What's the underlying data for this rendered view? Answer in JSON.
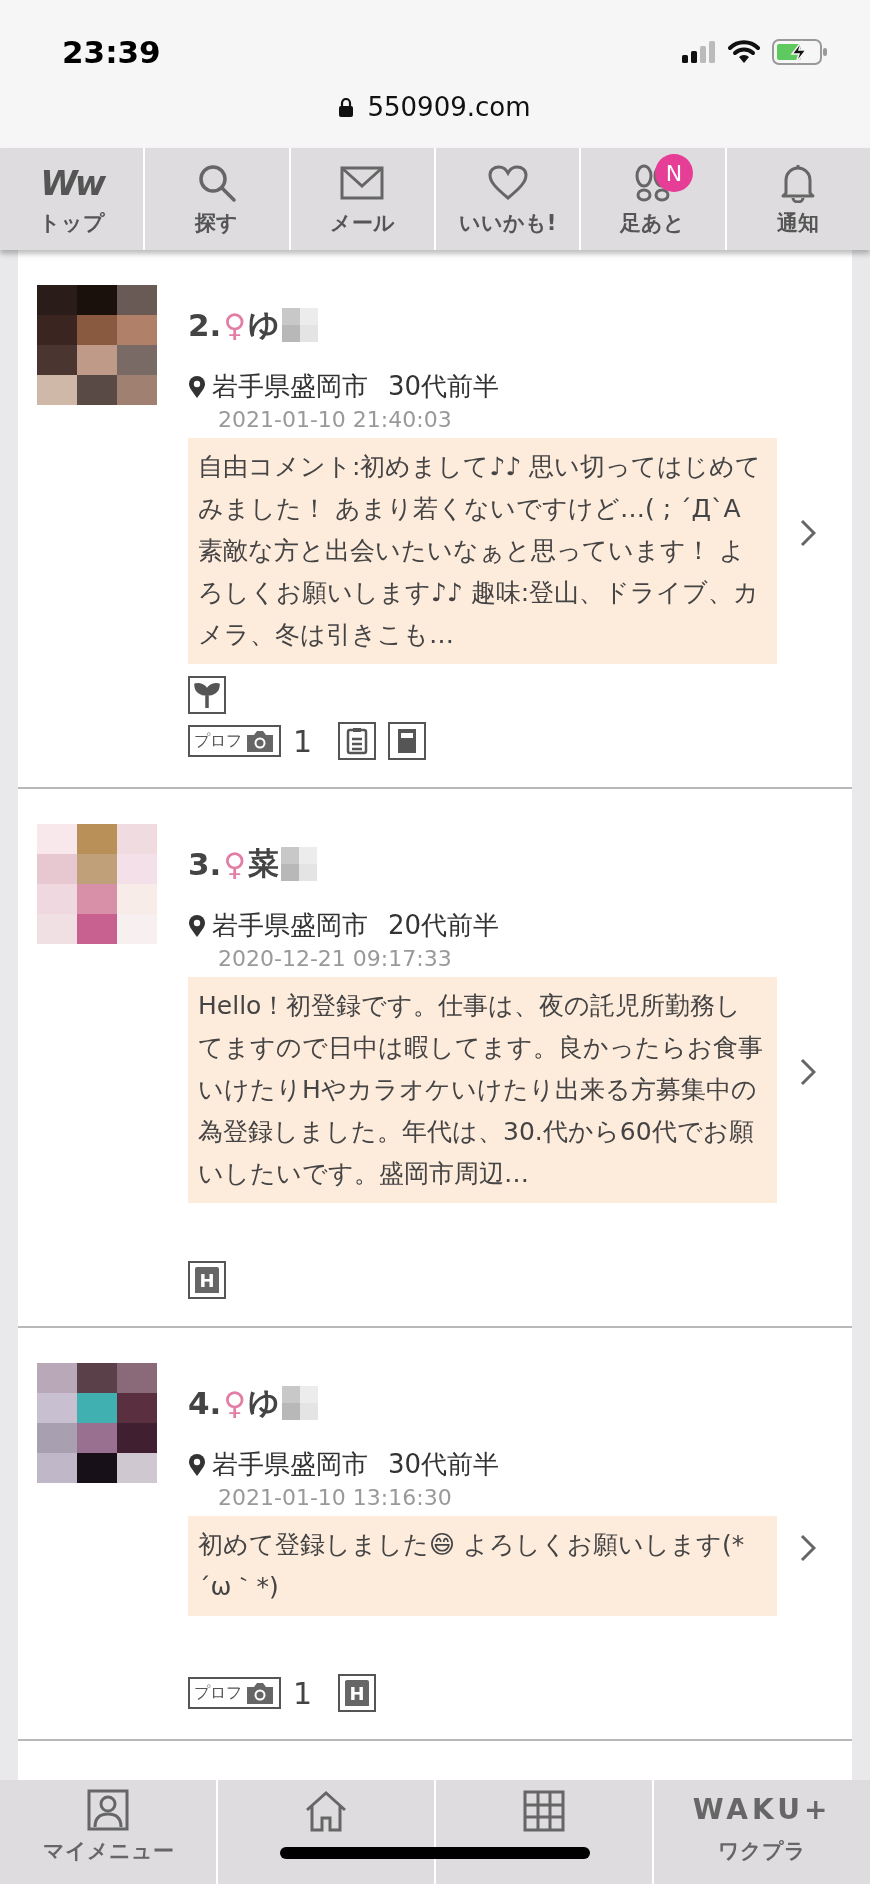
{
  "status_bar": {
    "time": "23:39"
  },
  "address_bar": {
    "url": "550909.com"
  },
  "top_nav": [
    {
      "kind": "logo",
      "logo": "Ww",
      "label": "トップ"
    },
    {
      "kind": "search",
      "label": "探す"
    },
    {
      "kind": "mail",
      "label": "メール"
    },
    {
      "kind": "heart",
      "label": "いいかも!"
    },
    {
      "kind": "footprints",
      "label": "足あと",
      "badge": "N"
    },
    {
      "kind": "bell",
      "label": "通知"
    }
  ],
  "profiles": [
    {
      "rank": "2.",
      "gender": "♀",
      "name": "ゆ",
      "location": "岩手県盛岡市",
      "age": "30代前半",
      "date": "2021-01-10 21:40:03",
      "comment": "自由コメント:初めまして♪♪ 思い切ってはじめてみました！ あまり若くないですけど…( ; ´Д`A 素敵な方と出会いたいなぁと思っています！ よろしくお願いします♪♪ 趣味:登山、ドライブ、カメラ、冬は引きこも…",
      "badge_rows": [
        [
          {
            "kind": "sprout"
          }
        ],
        [
          {
            "kind": "profile-photo",
            "label": "プロフ",
            "count": "1"
          },
          {
            "kind": "document"
          },
          {
            "kind": "notebook"
          }
        ]
      ]
    },
    {
      "rank": "3.",
      "gender": "♀",
      "name": "菜",
      "location": "岩手県盛岡市",
      "age": "20代前半",
      "date": "2020-12-21 09:17:33",
      "comment": "Hello！初登録です。仕事は、夜の託児所勤務してますので日中は暇してます。良かったらお食事いけたりHやカラオケいけたり出来る方募集中の為登録しました。年代は、30.代から60代でお願いしたいです。盛岡市周辺…",
      "badge_rows": [
        [
          {
            "kind": "letter",
            "label": "H"
          }
        ]
      ]
    },
    {
      "rank": "4.",
      "gender": "♀",
      "name": "ゆ",
      "location": "岩手県盛岡市",
      "age": "30代前半",
      "date": "2021-01-10 13:16:30",
      "comment": "初めて登録しました😄 よろしくお願いします(*´ω｀*)",
      "badge_rows": [
        [
          {
            "kind": "profile-photo",
            "label": "プロフ",
            "count": "1"
          },
          {
            "kind": "letter",
            "label": "H"
          }
        ]
      ]
    }
  ],
  "bottom_nav": [
    {
      "kind": "person",
      "label": "マイメニュー"
    },
    {
      "kind": "home"
    },
    {
      "kind": "grid"
    },
    {
      "kind": "logo",
      "logo": "WAKU+",
      "label": "ワクプラ"
    }
  ]
}
